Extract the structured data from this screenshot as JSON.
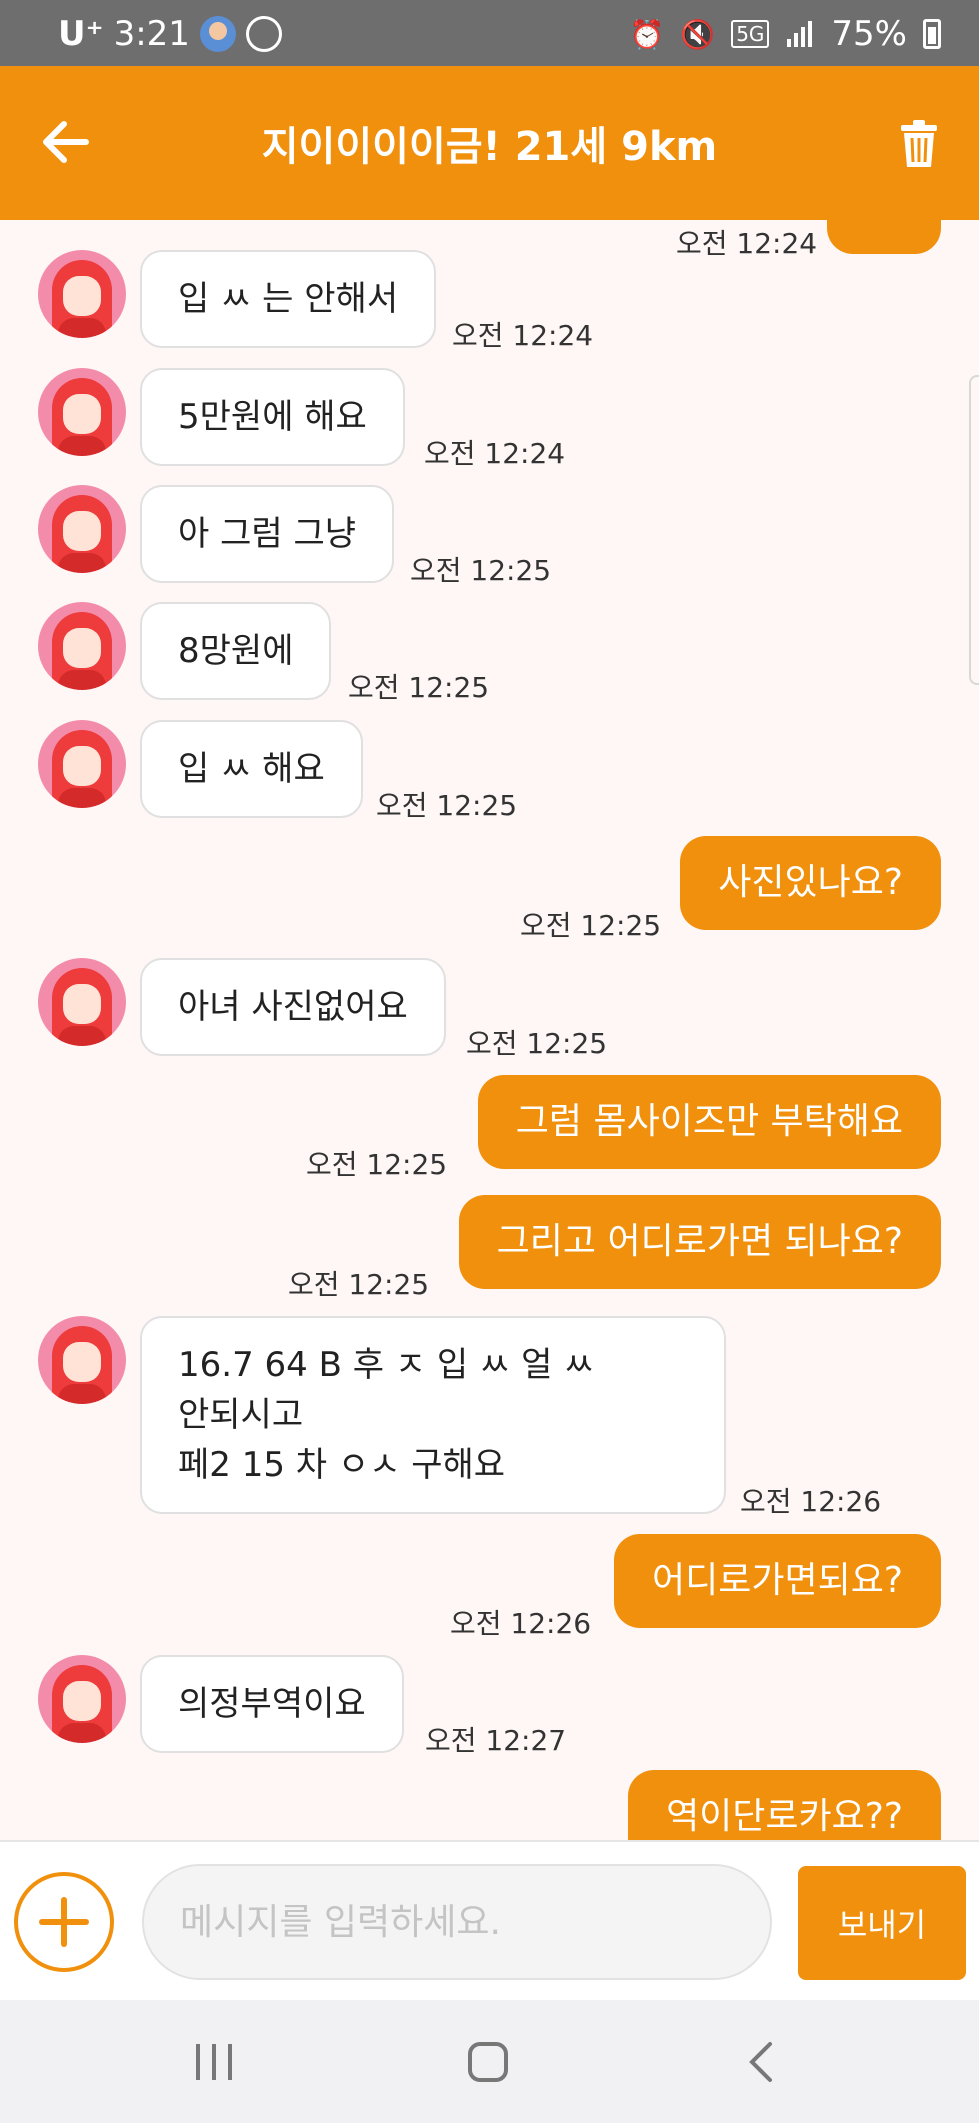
{
  "status_bar": {
    "carrier": "U⁺",
    "time": "3:21",
    "network": "5G",
    "battery": "75%"
  },
  "header": {
    "title": "지이이이이금! 21세 9km"
  },
  "messages": [
    {
      "side": "out",
      "text": "",
      "time": "오전 12:24"
    },
    {
      "side": "in",
      "text": "입 ㅆ 는 안해서",
      "time": "오전 12:24"
    },
    {
      "side": "in",
      "text": "5만원에 해요",
      "time": "오전 12:24"
    },
    {
      "side": "in",
      "text": "아 그럼 그냥",
      "time": "오전 12:25"
    },
    {
      "side": "in",
      "text": "8망원에",
      "time": "오전 12:25"
    },
    {
      "side": "in",
      "text": "입 ㅆ 해요",
      "time": "오전 12:25"
    },
    {
      "side": "out",
      "text": "사진있나요?",
      "time": "오전 12:25"
    },
    {
      "side": "in",
      "text": "아녀 사진없어요",
      "time": "오전 12:25"
    },
    {
      "side": "out",
      "text": "그럼 몸사이즈만 부탁해요",
      "time": "오전 12:25"
    },
    {
      "side": "out",
      "text": "그리고 어디로가면 되나요?",
      "time": "오전 12:25"
    },
    {
      "side": "in",
      "text": "16.7 64 B 후 ㅈ 입 ㅆ 얼 ㅆ\n안되시고\n 페2 15 차 ㅇㅅ 구해요",
      "time": "오전 12:26"
    },
    {
      "side": "out",
      "text": "어디로가면되요?",
      "time": "오전 12:26"
    },
    {
      "side": "in",
      "text": "의정부역이요",
      "time": "오전 12:27"
    },
    {
      "side": "out",
      "text": "역이단로카요??",
      "time": ""
    }
  ],
  "composer": {
    "placeholder": "메시지를 입력하세요.",
    "send_label": "보내기"
  },
  "colors": {
    "accent": "#f0900c",
    "background": "#fff6f6",
    "status_bar": "#6e6e6e"
  }
}
